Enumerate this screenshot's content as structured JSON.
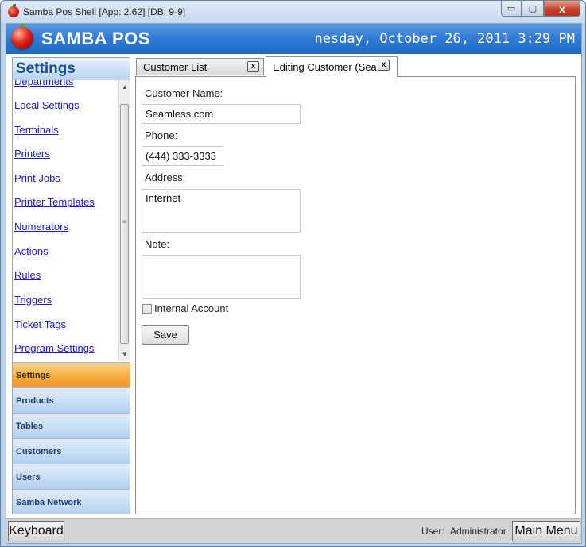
{
  "window": {
    "title": "Samba Pos Shell [App: 2.62] [DB: 9-9]",
    "controls": {
      "minimize": "▭",
      "maximize": "▢",
      "close": "x"
    }
  },
  "header": {
    "brand": "SAMBA POS",
    "datetime": "nesday, October 26, 2011 3:29 PM"
  },
  "sidebar": {
    "title": "Settings",
    "items": [
      "Departments",
      "Local Settings",
      "Terminals",
      "Printers",
      "Print Jobs",
      "Printer Templates",
      "Numerators",
      "Actions",
      "Rules",
      "Triggers",
      "Ticket Tags",
      "Program Settings"
    ],
    "nav": [
      "Settings",
      "Products",
      "Tables",
      "Customers",
      "Users",
      "Samba Network"
    ],
    "active_nav": "Settings"
  },
  "tabs": [
    {
      "label": "Customer List",
      "close": "x"
    },
    {
      "label": "Editing Customer (Sea",
      "close": "x"
    }
  ],
  "form": {
    "customer_name_label": "Customer Name:",
    "customer_name_value": "Seamless.com",
    "phone_label": "Phone:",
    "phone_value": "(444) 333-3333",
    "address_label": "Address:",
    "address_value": "Internet",
    "note_label": "Note:",
    "note_value": "",
    "internal_account_label": "Internal Account",
    "internal_account_checked": false,
    "save_label": "Save"
  },
  "statusbar": {
    "keyboard_label": "Keyboard",
    "user_label": "User:",
    "user_name": "Administrator",
    "main_menu_label": "Main Menu"
  }
}
